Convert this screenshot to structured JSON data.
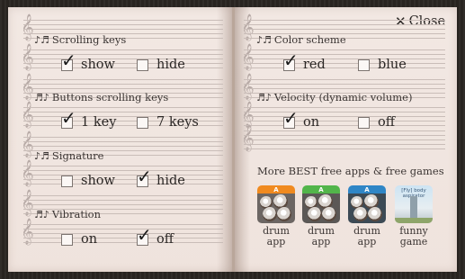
{
  "close_label": "Close",
  "left": {
    "scrolling_keys": {
      "title": "Scrolling keys",
      "note": "♪♬",
      "opt1": "show",
      "opt2": "hide",
      "selected": "show"
    },
    "buttons_scrolling": {
      "title": "Buttons scrolling keys",
      "note": "♬♪",
      "opt1": "1 key",
      "opt2": "7 keys",
      "selected": "1 key"
    },
    "signature": {
      "title": "Signature",
      "note": "♪♬",
      "opt1": "show",
      "opt2": "hide",
      "selected": "hide"
    },
    "vibration": {
      "title": "Vibration",
      "note": "♬♪",
      "opt1": "on",
      "opt2": "off",
      "selected": "off"
    }
  },
  "right": {
    "color_scheme": {
      "title": "Color scheme",
      "note": "♪♬",
      "opt1": "red",
      "opt2": "blue",
      "selected": "red"
    },
    "velocity": {
      "title": "Velocity (dynamic volume)",
      "note": "♬♪",
      "opt1": "on",
      "opt2": "off",
      "selected": "on"
    },
    "more_title": "More BEST free apps & free games",
    "apps": [
      {
        "line1": "drum",
        "line2": "app",
        "icon": "drum-app-orange-icon"
      },
      {
        "line1": "drum",
        "line2": "app",
        "icon": "drum-app-green-icon"
      },
      {
        "line1": "drum",
        "line2": "app",
        "icon": "drum-app-blue-icon"
      },
      {
        "line1": "funny",
        "line2": "game",
        "icon": "funny-game-icon",
        "icon_text": "[Fly] body aspirator"
      }
    ]
  },
  "colors": {
    "page": "#f2e8e3",
    "background": "#2a2622",
    "staff_line": "#c9bdb8",
    "text": "#2b2725"
  }
}
